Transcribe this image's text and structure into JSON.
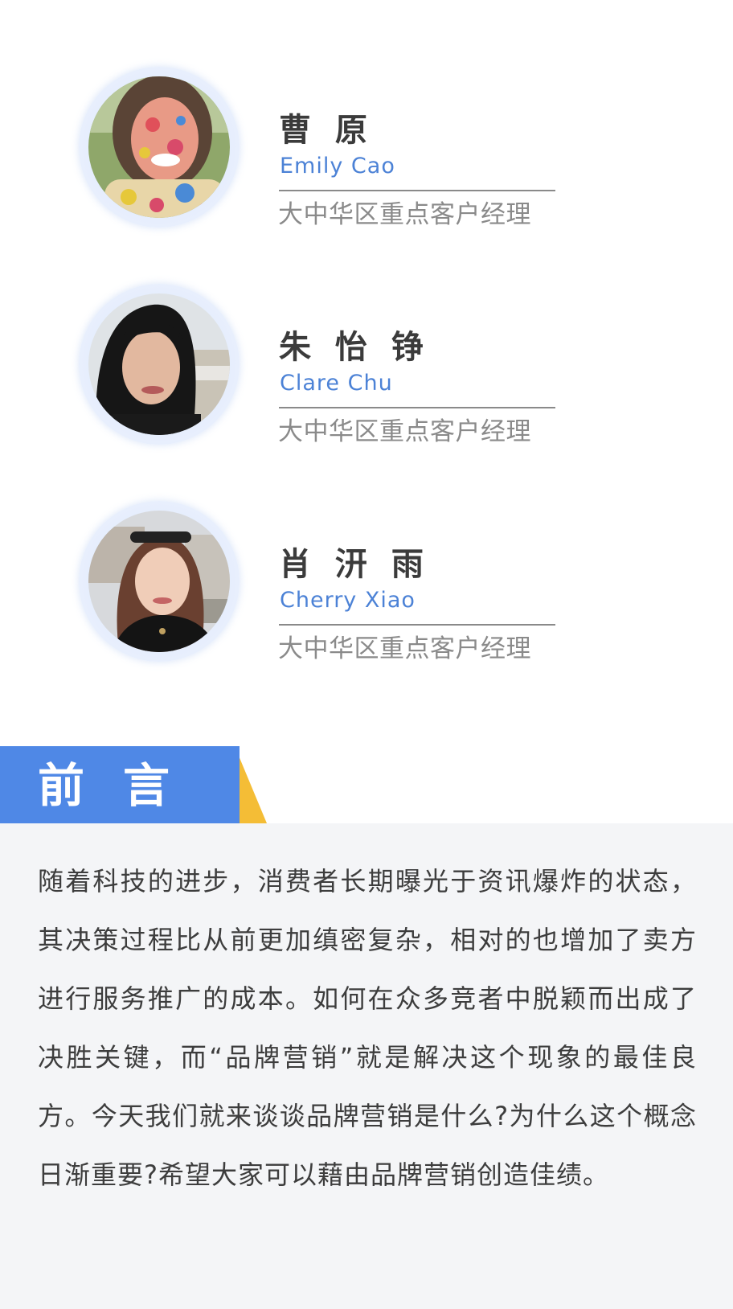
{
  "profiles": [
    {
      "name": "曹 原",
      "english_name": "Emily Cao",
      "title": "大中华区重点客户经理"
    },
    {
      "name": "朱 怡 铮",
      "english_name": "Clare Chu",
      "title": "大中华区重点客户经理"
    },
    {
      "name": "肖 汧 雨",
      "english_name": "Cherry Xiao",
      "title": "大中华区重点客户经理"
    }
  ],
  "section": {
    "title": "前言"
  },
  "intro": {
    "text": "随着科技的进步，消费者长期曝光于资讯爆炸的状态，其决策过程比从前更加缜密复杂，相对的也增加了卖方进行服务推广的成本。如何在众多竞者中脱颖而出成了决胜关键，而“品牌营销”就是解决这个现象的最佳良方。今天我们就来谈谈品牌营销是什么?为什么这个概念日渐重要?希望大家可以藉由品牌营销创造佳绩。"
  },
  "colors": {
    "accent_blue": "#4f88e6",
    "accent_yellow": "#f4bd36",
    "english_name": "#4c82d6",
    "name_text": "#3b3b3b",
    "body_text": "#3d3d3d",
    "muted_text": "#8a8a8a",
    "content_bg": "#f4f5f7"
  }
}
